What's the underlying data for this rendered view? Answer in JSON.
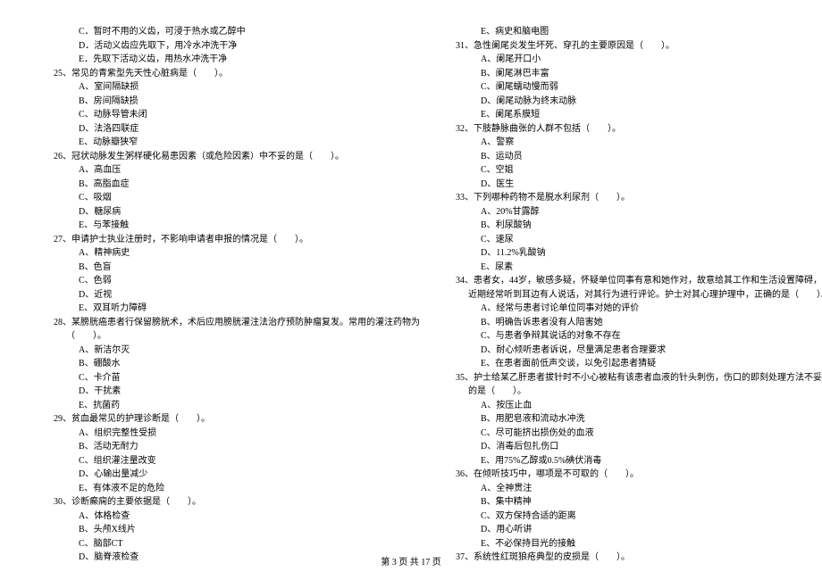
{
  "footer": "第 3 页  共 17 页",
  "left": [
    {
      "cls": "opt",
      "t": "C．暂时不用的义齿，可浸于热水或乙醇中"
    },
    {
      "cls": "opt",
      "t": "D．活动义齿应先取下，用冷水冲洗干净"
    },
    {
      "cls": "opt",
      "t": "E．先取下活动义齿，用热水冲洗干净"
    },
    {
      "cls": "q",
      "t": "25、常见的青紫型先天性心脏病是（　　）。"
    },
    {
      "cls": "opt",
      "t": "A、室间隔缺损"
    },
    {
      "cls": "opt",
      "t": "B、房间隔缺损"
    },
    {
      "cls": "opt",
      "t": "C、动脉导管未闭"
    },
    {
      "cls": "opt",
      "t": "D、法洛四联症"
    },
    {
      "cls": "opt",
      "t": "E、动脉瓣狭窄"
    },
    {
      "cls": "q",
      "t": "26、冠状动脉发生粥样硬化易患因素（或危险因素）中不妥的是（　　）。"
    },
    {
      "cls": "opt",
      "t": "A、高血压"
    },
    {
      "cls": "opt",
      "t": "B、高脂血症"
    },
    {
      "cls": "opt",
      "t": "C、吸烟"
    },
    {
      "cls": "opt",
      "t": "D、糖尿病"
    },
    {
      "cls": "opt",
      "t": "E、与苯接触"
    },
    {
      "cls": "q",
      "t": "27、申请护士执业注册时，不影响申请者申报的情况是（　　）。"
    },
    {
      "cls": "opt",
      "t": "A、精神病史"
    },
    {
      "cls": "opt",
      "t": "B、色盲"
    },
    {
      "cls": "opt",
      "t": "C、色弱"
    },
    {
      "cls": "opt",
      "t": "D、近视"
    },
    {
      "cls": "opt",
      "t": "E、双耳听力障碍"
    },
    {
      "cls": "q",
      "t": "28、某膀胱癌患者行保留膀胱术，术后应用膀胱灌注法治疗预防肿瘤复发。常用的灌注药物为"
    },
    {
      "cls": "cont",
      "t": "（　　）。"
    },
    {
      "cls": "opt",
      "t": "A、新洁尔灭"
    },
    {
      "cls": "opt",
      "t": "B、硼酸水"
    },
    {
      "cls": "opt",
      "t": "C、卡介苗"
    },
    {
      "cls": "opt",
      "t": "D、干扰素"
    },
    {
      "cls": "opt",
      "t": "E、抗菌药"
    },
    {
      "cls": "q",
      "t": "29、贫血最常见的护理诊断是（　　）。"
    },
    {
      "cls": "opt",
      "t": "A、组织完整性受损"
    },
    {
      "cls": "opt",
      "t": "B、活动无耐力"
    },
    {
      "cls": "opt",
      "t": "C、组织灌注量改变"
    },
    {
      "cls": "opt",
      "t": "D、心输出量减少"
    },
    {
      "cls": "opt",
      "t": "E、有体液不足的危险"
    },
    {
      "cls": "q",
      "t": "30、诊断癫痫的主要依据是（　　）。"
    },
    {
      "cls": "opt",
      "t": "A、体格检查"
    },
    {
      "cls": "opt",
      "t": "B、头颅X线片"
    },
    {
      "cls": "opt",
      "t": "C、脑部CT"
    },
    {
      "cls": "opt",
      "t": "D、脑脊液检查"
    }
  ],
  "right": [
    {
      "cls": "opt",
      "t": "E、病史和脑电图"
    },
    {
      "cls": "q",
      "t": "31、急性阑尾炎发生坏死、穿孔的主要原因是（　　）。"
    },
    {
      "cls": "opt",
      "t": "A、阑尾开口小"
    },
    {
      "cls": "opt",
      "t": "B、阑尾淋巴丰富"
    },
    {
      "cls": "opt",
      "t": "C、阑尾蠕动慢而弱"
    },
    {
      "cls": "opt",
      "t": "D、阑尾动脉为终末动脉"
    },
    {
      "cls": "opt",
      "t": "E、阑尾系膜短"
    },
    {
      "cls": "q",
      "t": "32、下肢静脉曲张的人群不包括（　　）。"
    },
    {
      "cls": "opt",
      "t": "A、警察"
    },
    {
      "cls": "opt",
      "t": "B、运动员"
    },
    {
      "cls": "opt",
      "t": "C、空姐"
    },
    {
      "cls": "opt",
      "t": "D、医生"
    },
    {
      "cls": "q",
      "t": "33、下列哪种药物不是脱水利尿剂（　　）。"
    },
    {
      "cls": "opt",
      "t": "A、20%甘露醇"
    },
    {
      "cls": "opt",
      "t": "B、利尿酸钠"
    },
    {
      "cls": "opt",
      "t": "C、速尿"
    },
    {
      "cls": "opt",
      "t": "D、11.2%乳酸钠"
    },
    {
      "cls": "opt",
      "t": "E、尿素"
    },
    {
      "cls": "q",
      "t": "34、患者女，44岁，敏感多疑，怀疑单位同事有意和她作对，故意给其工作和生活设置障碍，"
    },
    {
      "cls": "cont",
      "t": "近期经常听到耳边有人说话，对其行为进行评论。护士对其心理护理中，正确的是（　　）。"
    },
    {
      "cls": "opt",
      "t": "A、经常与患者讨论单位同事对她的评价"
    },
    {
      "cls": "opt",
      "t": "B、明确告诉患者没有人陪害她"
    },
    {
      "cls": "opt",
      "t": "C、与患者争辩其说话的对象不存在"
    },
    {
      "cls": "opt",
      "t": "D、耐心倾听患者诉说，尽量满足患者合理要求"
    },
    {
      "cls": "opt",
      "t": "E、在患者面前低声交谈，以免引起患者猜疑"
    },
    {
      "cls": "q",
      "t": "35、护士给某乙肝患者拔针时不小心被粘有该患者血液的针头刺伤，伤口的即刻处理方法不妥"
    },
    {
      "cls": "cont",
      "t": "的是（　　）。"
    },
    {
      "cls": "opt",
      "t": "A、按压止血"
    },
    {
      "cls": "opt",
      "t": "B、用肥皂液和流动水冲洗"
    },
    {
      "cls": "opt",
      "t": "C、尽可能挤出损伤处的血液"
    },
    {
      "cls": "opt",
      "t": "D、消毒后包扎伤口"
    },
    {
      "cls": "opt",
      "t": "E、用75%乙醇或0.5%碘伏消毒"
    },
    {
      "cls": "q",
      "t": "36、在倾听技巧中，哪项是不可取的（　　）。"
    },
    {
      "cls": "opt",
      "t": "A、全神贯注"
    },
    {
      "cls": "opt",
      "t": "B、集中精神"
    },
    {
      "cls": "opt",
      "t": "C、双方保持合适的距离"
    },
    {
      "cls": "opt",
      "t": "D、用心听讲"
    },
    {
      "cls": "opt",
      "t": "E、不必保持目光的接触"
    },
    {
      "cls": "q",
      "t": "37、系统性红斑狼疮典型的皮损是（　　）。"
    }
  ]
}
